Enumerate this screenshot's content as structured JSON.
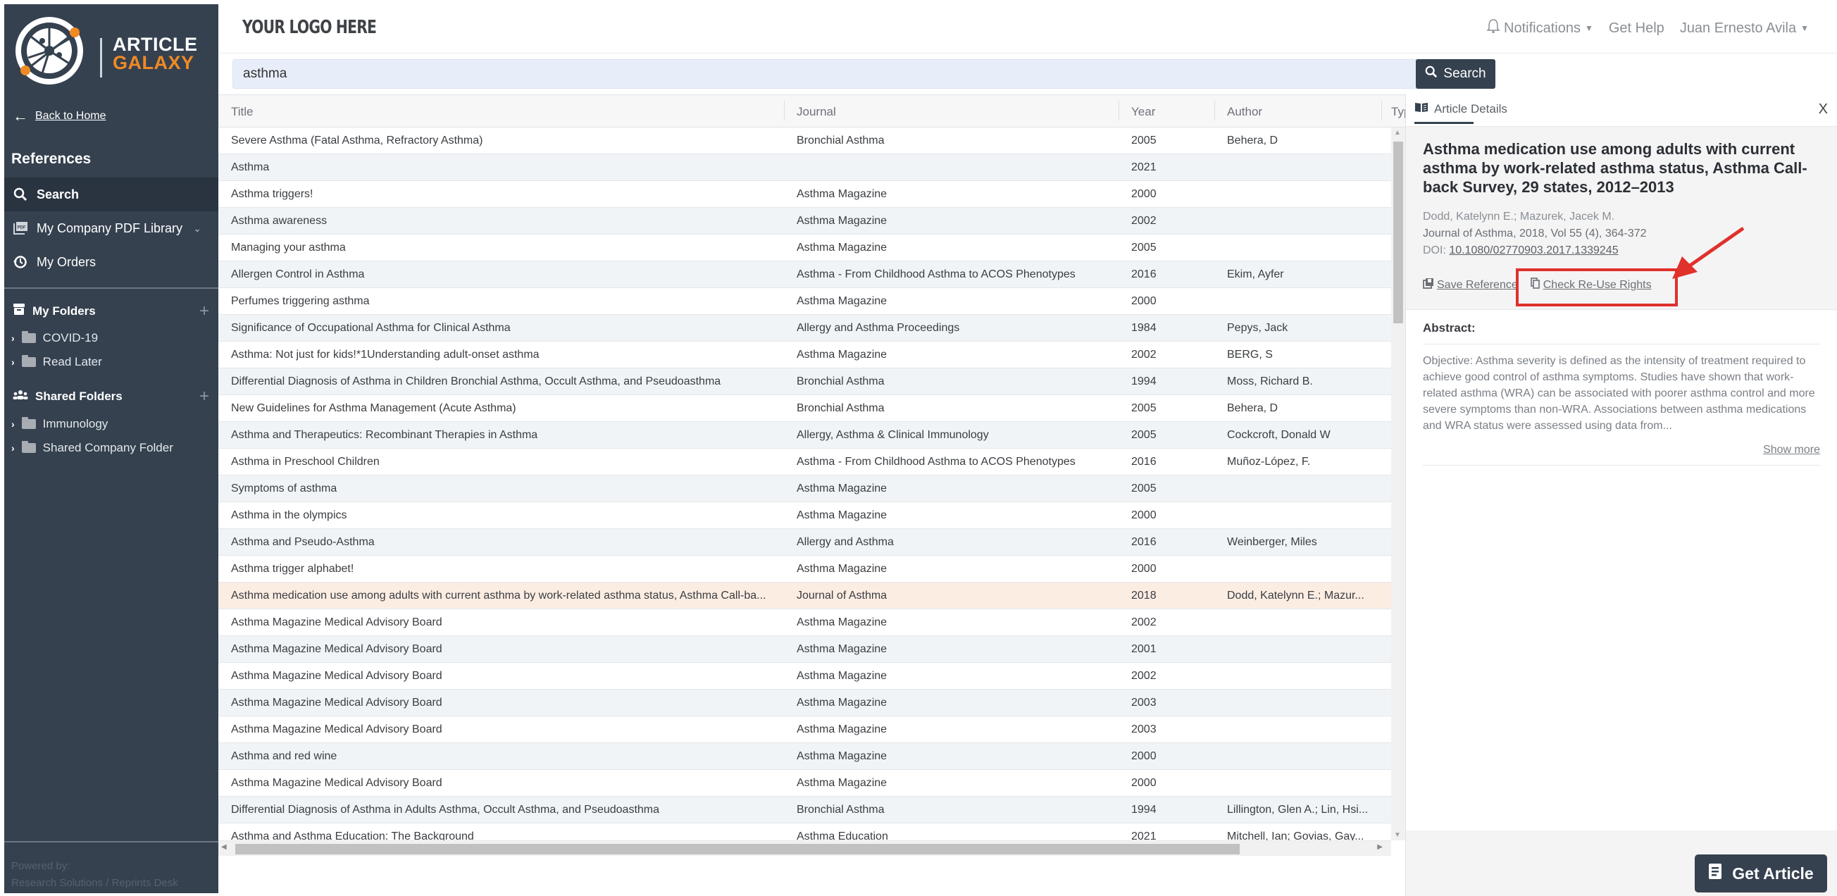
{
  "brand": {
    "line1": "ARTICLE",
    "line2": "GALAXY",
    "accent": "#f08a24",
    "sidebar_bg": "#35414f"
  },
  "sidebar": {
    "back_label": "Back to Home",
    "references_title": "References",
    "nav": [
      {
        "label": "Search",
        "icon": "search-icon",
        "active": true
      },
      {
        "label": "My Company PDF Library",
        "icon": "pdf-library-icon",
        "active": false
      },
      {
        "label": "My Orders",
        "icon": "history-icon",
        "active": false
      }
    ],
    "my_folders": {
      "title": "My Folders",
      "items": [
        "COVID-19",
        "Read Later"
      ]
    },
    "shared_folders": {
      "title": "Shared Folders",
      "items": [
        "Immunology",
        "Shared Company Folder"
      ]
    },
    "powered_by": "Powered by:",
    "powered_company": "Research Solutions / Reprints Desk"
  },
  "header": {
    "logo_placeholder": "YOUR LOGO HERE",
    "notifications": "Notifications",
    "help": "Get Help",
    "user": "Juan Ernesto Avila"
  },
  "search": {
    "value": "asthma",
    "button": "Search"
  },
  "table": {
    "columns": [
      "Title",
      "Journal",
      "Year",
      "Author",
      "Typ"
    ],
    "rows": [
      {
        "title": "Severe Asthma (Fatal Asthma, Refractory Asthma)",
        "journal": "Bronchial Asthma",
        "year": "2005",
        "author": "Behera, D"
      },
      {
        "title": "Asthma",
        "journal": "",
        "year": "2021",
        "author": ""
      },
      {
        "title": "Asthma triggers!",
        "journal": "Asthma Magazine",
        "year": "2000",
        "author": ""
      },
      {
        "title": "Asthma awareness",
        "journal": "Asthma Magazine",
        "year": "2002",
        "author": ""
      },
      {
        "title": "Managing your asthma",
        "journal": "Asthma Magazine",
        "year": "2005",
        "author": ""
      },
      {
        "title": "Allergen Control in Asthma",
        "journal": "Asthma - From Childhood Asthma to ACOS Phenotypes",
        "year": "2016",
        "author": "Ekim, Ayfer"
      },
      {
        "title": "Perfumes triggering asthma",
        "journal": "Asthma Magazine",
        "year": "2000",
        "author": ""
      },
      {
        "title": "Significance of Occupational Asthma for Clinical Asthma",
        "journal": "Allergy and Asthma Proceedings",
        "year": "1984",
        "author": "Pepys, Jack"
      },
      {
        "title": "Asthma: Not just for kids!*1Understanding adult-onset asthma",
        "journal": "Asthma Magazine",
        "year": "2002",
        "author": "BERG, S"
      },
      {
        "title": "Differential Diagnosis of Asthma in Children Bronchial Asthma, Occult Asthma, and Pseudoasthma",
        "journal": "Bronchial Asthma",
        "year": "1994",
        "author": "Moss, Richard B."
      },
      {
        "title": "New Guidelines for Asthma Management (Acute Asthma)",
        "journal": "Bronchial Asthma",
        "year": "2005",
        "author": "Behera, D"
      },
      {
        "title": "Asthma and Therapeutics: Recombinant Therapies in Asthma",
        "journal": "Allergy, Asthma & Clinical Immunology",
        "year": "2005",
        "author": "Cockcroft, Donald W"
      },
      {
        "title": "Asthma in Preschool Children",
        "journal": "Asthma - From Childhood Asthma to ACOS Phenotypes",
        "year": "2016",
        "author": "Muñoz-López, F."
      },
      {
        "title": "Symptoms of asthma",
        "journal": "Asthma Magazine",
        "year": "2005",
        "author": ""
      },
      {
        "title": "Asthma in the olympics",
        "journal": "Asthma Magazine",
        "year": "2000",
        "author": ""
      },
      {
        "title": "Asthma and Pseudo-Asthma",
        "journal": "Allergy and Asthma",
        "year": "2016",
        "author": "Weinberger, Miles"
      },
      {
        "title": "Asthma trigger alphabet!",
        "journal": "Asthma Magazine",
        "year": "2000",
        "author": ""
      },
      {
        "title": "Asthma medication use among adults with current asthma by work-related asthma status, Asthma Call-ba...",
        "journal": "Journal of Asthma",
        "year": "2018",
        "author": "Dodd, Katelynn E.; Mazur...",
        "selected": true
      },
      {
        "title": "Asthma Magazine Medical Advisory Board",
        "journal": "Asthma Magazine",
        "year": "2002",
        "author": ""
      },
      {
        "title": "Asthma Magazine Medical Advisory Board",
        "journal": "Asthma Magazine",
        "year": "2001",
        "author": ""
      },
      {
        "title": "Asthma Magazine Medical Advisory Board",
        "journal": "Asthma Magazine",
        "year": "2002",
        "author": ""
      },
      {
        "title": "Asthma Magazine Medical Advisory Board",
        "journal": "Asthma Magazine",
        "year": "2003",
        "author": ""
      },
      {
        "title": "Asthma Magazine Medical Advisory Board",
        "journal": "Asthma Magazine",
        "year": "2003",
        "author": ""
      },
      {
        "title": "Asthma and red wine",
        "journal": "Asthma Magazine",
        "year": "2000",
        "author": ""
      },
      {
        "title": "Asthma Magazine Medical Advisory Board",
        "journal": "Asthma Magazine",
        "year": "2000",
        "author": ""
      },
      {
        "title": "Differential Diagnosis of Asthma in Adults Asthma, Occult Asthma, and Pseudoasthma",
        "journal": "Bronchial Asthma",
        "year": "1994",
        "author": "Lillington, Glen A.; Lin, Hsi..."
      },
      {
        "title": "Asthma and Asthma Education: The Background",
        "journal": "Asthma Education",
        "year": "2021",
        "author": "Mitchell, Ian; Govias, Gay..."
      }
    ]
  },
  "article": {
    "tab_label": "Article Details",
    "close_label": "X",
    "title": "Asthma medication use among adults with current asthma by work-related asthma status, Asthma Call-back Survey, 29 states, 2012–2013",
    "authors": "Dodd, Katelynn E.; Mazurek, Jacek M.",
    "journal_line": "Journal of Asthma, 2018, Vol 55 (4), 364-372",
    "doi_label": "DOI:",
    "doi": "10.1080/02770903.2017.1339245",
    "save_reference": "Save Reference",
    "check_rights": "Check Re-Use Rights",
    "abstract_label": "Abstract:",
    "abstract_text": "Objective: Asthma severity is defined as the intensity of treatment required to achieve good control of asthma symptoms. Studies have shown that work-related asthma (WRA) can be associated with poorer asthma control and more severe symptoms than non-WRA. Associations between asthma medications and WRA status were assessed using data from...",
    "show_more": "Show more",
    "get_article": "Get Article",
    "annotation_color": "#e0312b"
  }
}
